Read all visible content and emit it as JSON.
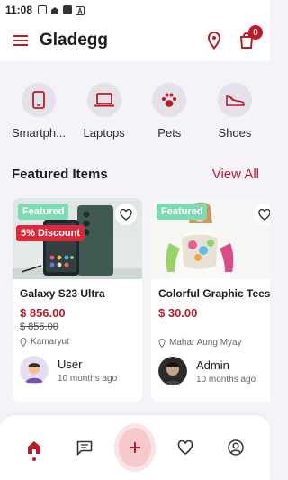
{
  "status_bar": {
    "time": "11:08"
  },
  "app_bar": {
    "title": "Gladegg",
    "cart_count": "0"
  },
  "categories": [
    {
      "label": "Smartph...",
      "icon": "smartphone-icon"
    },
    {
      "label": "Laptops",
      "icon": "laptop-icon"
    },
    {
      "label": "Pets",
      "icon": "paw-icon"
    },
    {
      "label": "Shoes",
      "icon": "shoe-icon"
    }
  ],
  "featured": {
    "title": "Featured Items",
    "view_all": "View All",
    "items": [
      {
        "featured_tag": "Featured",
        "discount_tag": "5% Discount",
        "name": "Galaxy S23 Ultra",
        "price": "$ 856.00",
        "old_price": "$ 856.00",
        "location": "Kamaryut",
        "seller_name": "User",
        "seller_time": "10 months ago"
      },
      {
        "featured_tag": "Featured",
        "name": "Colorful Graphic Tees...",
        "price": "$ 30.00",
        "location": "Mahar Aung Myay",
        "seller_name": "Admin",
        "seller_time": "10 months ago"
      }
    ]
  },
  "bottom_nav": [
    {
      "icon": "home-icon",
      "active": true
    },
    {
      "icon": "chat-icon",
      "active": false
    },
    {
      "icon": "plus-icon",
      "active": false
    },
    {
      "icon": "heart-icon",
      "active": false
    },
    {
      "icon": "profile-icon",
      "active": false
    }
  ],
  "colors": {
    "accent": "#b71c2b",
    "featured_tag": "#7fd9b4",
    "discount_tag": "#d92b3b",
    "background": "#f5f3f7"
  }
}
